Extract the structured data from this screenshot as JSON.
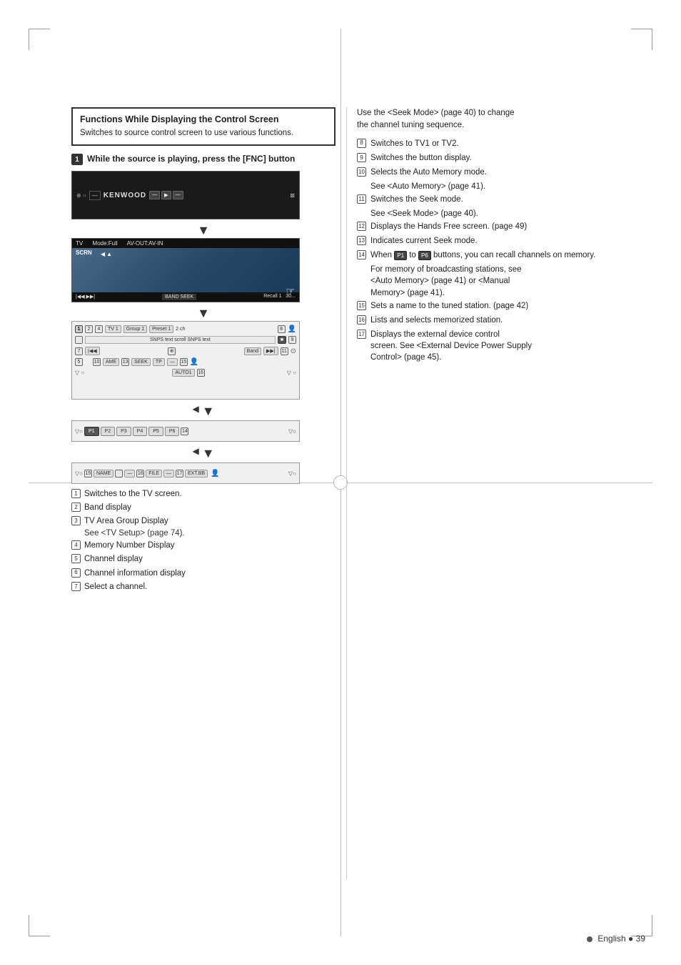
{
  "page": {
    "number": "39",
    "language": "English"
  },
  "section": {
    "title": "Functions While Displaying the Control Screen",
    "description": "Switches to source control screen to use various functions."
  },
  "step1": {
    "number": "1",
    "text": "While the source is playing, press the [FNC] button"
  },
  "screens": {
    "screen1_label": "Initial device bar",
    "tv_topbar": "TV    Mode:Full    AV-OUT:AV-IN",
    "tv_label": "SCRN",
    "preset_buttons": [
      "P1",
      "P2",
      "P3",
      "P4",
      "P5",
      "P6"
    ],
    "name_buttons": [
      "NAME",
      "FILE",
      "EXT.BB"
    ]
  },
  "left_list": {
    "items": [
      {
        "num": "1",
        "text": "Switches to the TV screen."
      },
      {
        "num": "2",
        "text": "Band display"
      },
      {
        "num": "3",
        "text": "TV Area Group Display",
        "sub": "See <TV Setup> (page 74)."
      },
      {
        "num": "4",
        "text": "Memory Number Display"
      },
      {
        "num": "5",
        "text": "Channel display"
      },
      {
        "num": "6",
        "text": "Channel information display"
      },
      {
        "num": "7",
        "text": "Select a channel."
      }
    ]
  },
  "right_list": {
    "intro": "Use the <Seek Mode> (page 40) to change the channel tuning sequence.",
    "items": [
      {
        "num": "8",
        "text": "Switches to TV1 or TV2."
      },
      {
        "num": "9",
        "text": "Switches the button display."
      },
      {
        "num": "10",
        "text": "Selects the Auto Memory mode.",
        "sub": "See <Auto Memory> (page 41)."
      },
      {
        "num": "11",
        "text": "Switches the Seek mode.",
        "sub": "See <Seek Mode> (page 40)."
      },
      {
        "num": "12",
        "text": "Displays the Hands Free screen. (page 49)"
      },
      {
        "num": "13",
        "text": "Indicates current Seek mode."
      },
      {
        "num": "14",
        "text": "When",
        "btn1": "P1",
        "btn2": "P6",
        "text2": "buttons, you can recall channels on memory.",
        "sub1": "For memory of broadcasting stations, see <Auto Memory> (page 41) or <Manual Memory> (page 41)."
      },
      {
        "num": "15",
        "text": "Sets a name to the tuned station. (page 42)"
      },
      {
        "num": "16",
        "text": "Lists and selects memorized station."
      },
      {
        "num": "17",
        "text": "Displays the external device control screen. See <External Device Power Supply Control> (page 45)."
      }
    ]
  }
}
